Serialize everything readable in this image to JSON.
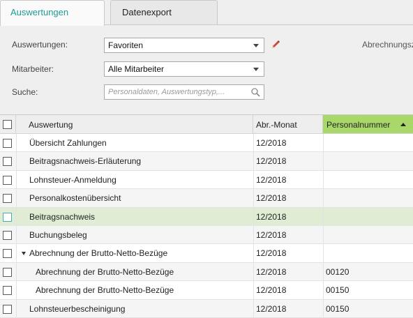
{
  "tabs": [
    {
      "label": "Auswertungen",
      "active": true
    },
    {
      "label": "Datenexport",
      "active": false
    }
  ],
  "form": {
    "auswertungen_label": "Auswertungen:",
    "auswertungen_value": "Favoriten",
    "mitarbeiter_label": "Mitarbeiter:",
    "mitarbeiter_value": "Alle Mitarbeiter",
    "suche_label": "Suche:",
    "suche_placeholder": "Personaldaten, Auswertungstyp,...",
    "right_label": "Abrechnungsz"
  },
  "grid": {
    "columns": {
      "name": "Auswertung",
      "month": "Abr.-Monat",
      "pnr": "Personalnummer"
    },
    "rows": [
      {
        "name": "Übersicht Zahlungen",
        "month": "12/2018",
        "pnr": "",
        "child": false,
        "expander": false,
        "selected": false
      },
      {
        "name": "Beitragsnachweis-Erläuterung",
        "month": "12/2018",
        "pnr": "",
        "child": false,
        "expander": false,
        "selected": false
      },
      {
        "name": "Lohnsteuer-Anmeldung",
        "month": "12/2018",
        "pnr": "",
        "child": false,
        "expander": false,
        "selected": false
      },
      {
        "name": "Personalkostenübersicht",
        "month": "12/2018",
        "pnr": "",
        "child": false,
        "expander": false,
        "selected": false
      },
      {
        "name": "Beitragsnachweis",
        "month": "12/2018",
        "pnr": "",
        "child": false,
        "expander": false,
        "selected": true
      },
      {
        "name": "Buchungsbeleg",
        "month": "12/2018",
        "pnr": "",
        "child": false,
        "expander": false,
        "selected": false
      },
      {
        "name": "Abrechnung der Brutto-Netto-Bezüge",
        "month": "12/2018",
        "pnr": "",
        "child": false,
        "expander": true,
        "selected": false
      },
      {
        "name": "Abrechnung der Brutto-Netto-Bezüge",
        "month": "12/2018",
        "pnr": "00120",
        "child": true,
        "expander": false,
        "selected": false
      },
      {
        "name": "Abrechnung der Brutto-Netto-Bezüge",
        "month": "12/2018",
        "pnr": "00150",
        "child": true,
        "expander": false,
        "selected": false
      },
      {
        "name": "Lohnsteuerbescheinigung",
        "month": "12/2018",
        "pnr": "00150",
        "child": false,
        "expander": false,
        "selected": false
      }
    ]
  },
  "colors": {
    "accent": "#1e9a96",
    "sorted_column": "#a8d86a",
    "selected_row": "#e1ecd4",
    "pencil": "#c0392b"
  }
}
